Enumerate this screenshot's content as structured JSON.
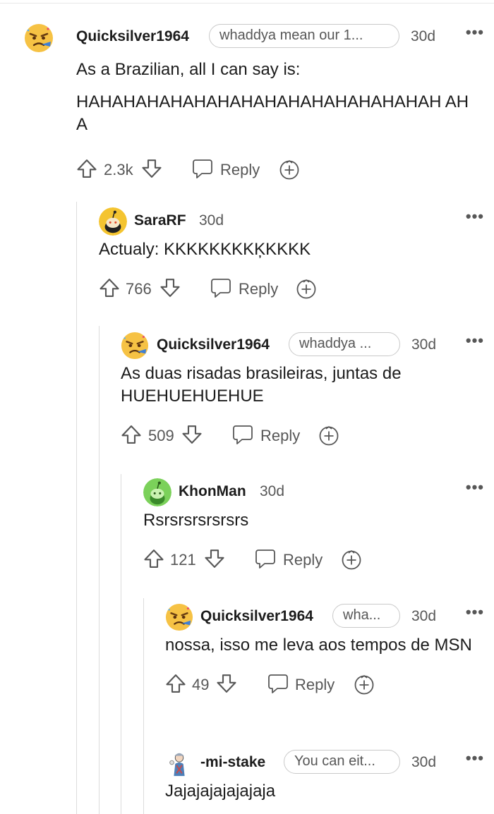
{
  "comments": [
    {
      "username": "Quicksilver1964",
      "flair": "whaddya mean our 1...",
      "age": "30d",
      "body": [
        "As a Brazilian, all I can say is:",
        "HAHAHAHAHAHAHAHAHAHAHAHAHAHAHAH AHA"
      ],
      "votes": "2.3k",
      "reply_label": "Reply",
      "avatar": "angry-emoji-avatar"
    },
    {
      "username": "SaraRF",
      "flair": "",
      "age": "30d",
      "body": [
        "Actualy: KKKKKKKKĶKKKK"
      ],
      "votes": "766",
      "reply_label": "Reply",
      "avatar": "snoo-yellow-avatar"
    },
    {
      "username": "Quicksilver1964",
      "flair": "whaddya ...",
      "age": "30d",
      "body": [
        "As duas risadas brasileiras, juntas de HUEHUEHUEHUE"
      ],
      "votes": "509",
      "reply_label": "Reply",
      "avatar": "angry-emoji-avatar"
    },
    {
      "username": "KhonMan",
      "flair": "",
      "age": "30d",
      "body": [
        "Rsrsrsrsrsrsrs"
      ],
      "votes": "121",
      "reply_label": "Reply",
      "avatar": "snoo-green-avatar"
    },
    {
      "username": "Quicksilver1964",
      "flair": "wha...",
      "age": "30d",
      "body": [
        "nossa, isso me leva aos tempos de MSN"
      ],
      "votes": "49",
      "reply_label": "Reply",
      "avatar": "angry-emoji-avatar"
    },
    {
      "username": "-mi-stake",
      "flair": "You can eit...",
      "age": "30d",
      "body": [
        "Jajajajajajajaja"
      ],
      "votes": "",
      "reply_label": "",
      "avatar": "character-avatar"
    }
  ],
  "more_icon": "more-options-icon",
  "colors": {
    "text": "#1c1c1c",
    "meta": "#575757",
    "thread_line": "#dcdcdc",
    "emoji": "#f6c244"
  }
}
